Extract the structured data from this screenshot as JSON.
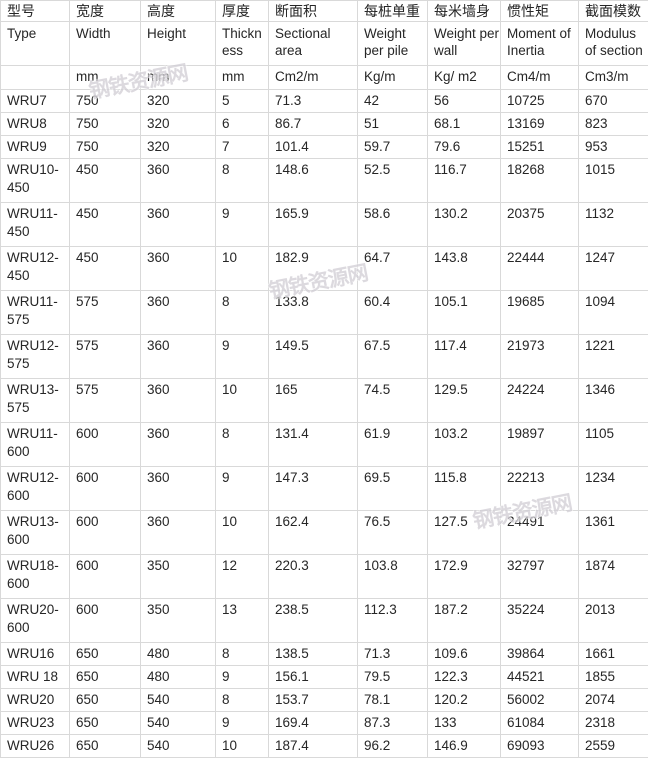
{
  "table": {
    "header_cn": [
      "型号",
      "宽度",
      "高度",
      "厚度",
      "断面积",
      "每桩单重",
      "每米墙身",
      "惯性矩",
      "截面模数"
    ],
    "header_en": [
      "Type",
      "Width",
      "Height",
      "Thickness",
      "Sectional area",
      "Weight per pile",
      "Weight per wall",
      "Moment of Inertia",
      "Modulus of section"
    ],
    "header_units": [
      "",
      "mm",
      "mm",
      "mm",
      "Cm2/m",
      "Kg/m",
      "Kg/ m2",
      "Cm4/m",
      "Cm3/m"
    ],
    "rows": [
      {
        "cells": [
          "WRU7",
          "750",
          "320",
          "5",
          "71.3",
          "42",
          "56",
          "10725",
          "670"
        ],
        "tall": false
      },
      {
        "cells": [
          "WRU8",
          "750",
          "320",
          "6",
          "86.7",
          "51",
          "68.1",
          "13169",
          "823"
        ],
        "tall": false
      },
      {
        "cells": [
          "WRU9",
          "750",
          "320",
          "7",
          "101.4",
          "59.7",
          "79.6",
          "15251",
          "953"
        ],
        "tall": false
      },
      {
        "cells": [
          "WRU10-450",
          "450",
          "360",
          "8",
          "148.6",
          "52.5",
          "116.7",
          "18268",
          "1015"
        ],
        "tall": true
      },
      {
        "cells": [
          "WRU11-450",
          "450",
          "360",
          "9",
          "165.9",
          "58.6",
          "130.2",
          "20375",
          "1132"
        ],
        "tall": true
      },
      {
        "cells": [
          "WRU12-450",
          "450",
          "360",
          "10",
          "182.9",
          "64.7",
          "143.8",
          "22444",
          "1247"
        ],
        "tall": true
      },
      {
        "cells": [
          "WRU11-575",
          "575",
          "360",
          "8",
          "133.8",
          "60.4",
          "105.1",
          "19685",
          "1094"
        ],
        "tall": true
      },
      {
        "cells": [
          "WRU12-575",
          "575",
          "360",
          "9",
          "149.5",
          "67.5",
          "117.4",
          "21973",
          "1221"
        ],
        "tall": true
      },
      {
        "cells": [
          "WRU13-575",
          "575",
          "360",
          "10",
          "165",
          "74.5",
          "129.5",
          "24224",
          "1346"
        ],
        "tall": true
      },
      {
        "cells": [
          "WRU11-600",
          "600",
          "360",
          "8",
          "131.4",
          "61.9",
          "103.2",
          "19897",
          "1105"
        ],
        "tall": true
      },
      {
        "cells": [
          "WRU12-600",
          "600",
          "360",
          "9",
          "147.3",
          "69.5",
          "115.8",
          "22213",
          "1234"
        ],
        "tall": true
      },
      {
        "cells": [
          "WRU13-600",
          "600",
          "360",
          "10",
          "162.4",
          "76.5",
          "127.5",
          "24491",
          "1361"
        ],
        "tall": true
      },
      {
        "cells": [
          "WRU18-600",
          "600",
          "350",
          "12",
          "220.3",
          "103.8",
          "172.9",
          "32797",
          "1874"
        ],
        "tall": true
      },
      {
        "cells": [
          "WRU20-600",
          "600",
          "350",
          "13",
          "238.5",
          "112.3",
          "187.2",
          "35224",
          "2013"
        ],
        "tall": true
      },
      {
        "cells": [
          "WRU16",
          "650",
          "480",
          "8",
          "138.5",
          "71.3",
          "109.6",
          "39864",
          "1661"
        ],
        "tall": false
      },
      {
        "cells": [
          "WRU 18",
          "650",
          "480",
          "9",
          "156.1",
          "79.5",
          "122.3",
          "44521",
          "1855"
        ],
        "tall": false
      },
      {
        "cells": [
          "WRU20",
          "650",
          "540",
          "8",
          "153.7",
          "78.1",
          "120.2",
          "56002",
          "2074"
        ],
        "tall": false
      },
      {
        "cells": [
          "WRU23",
          "650",
          "540",
          "9",
          "169.4",
          "87.3",
          "133",
          "61084",
          "2318"
        ],
        "tall": false
      },
      {
        "cells": [
          "WRU26",
          "650",
          "540",
          "10",
          "187.4",
          "96.2",
          "146.9",
          "69093",
          "2559"
        ],
        "tall": false
      }
    ]
  },
  "watermark": {
    "text": "钢铁资源网",
    "color": "#786e82"
  }
}
